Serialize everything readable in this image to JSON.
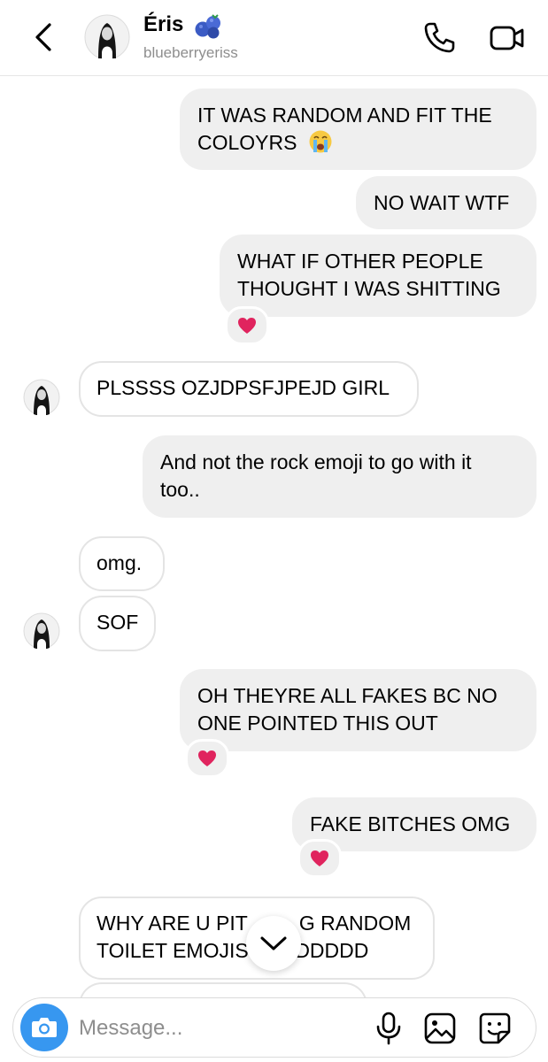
{
  "header": {
    "name": "Éris",
    "username": "blueberryeriss",
    "name_emoji_icon": "blueberries-emoji",
    "back_icon": "chevron-left-icon",
    "call_icon": "phone-icon",
    "video_icon": "video-camera-icon"
  },
  "messages": [
    {
      "side": "sent",
      "lines": [
        "IT WAS RANDOM AND FIT THE",
        "COLOYRS"
      ],
      "emoji": "loudly-crying-face"
    },
    {
      "side": "sent",
      "lines": [
        "NO WAIT WTF"
      ]
    },
    {
      "side": "sent",
      "lines": [
        "WHAT IF OTHER PEOPLE",
        "THOUGHT I WAS SHITTING"
      ],
      "reaction": "red-heart"
    },
    {
      "side": "received",
      "lines": [
        "PLSSSS OZJDPSFJPEJD GIRL"
      ],
      "avatar": true
    },
    {
      "side": "sent",
      "lines": [
        "And not the rock emoji to go with it",
        "too.."
      ]
    },
    {
      "side": "received",
      "lines": [
        "omg."
      ]
    },
    {
      "side": "received",
      "lines": [
        "SOF"
      ],
      "avatar": true
    },
    {
      "side": "sent",
      "lines": [
        "OH THEYRE ALL FAKES BC NO",
        "ONE POINTED THIS OUT"
      ],
      "reaction": "red-heart"
    },
    {
      "side": "sent",
      "lines": [
        "FAKE BITCHES OMG"
      ],
      "reaction": "red-heart"
    },
    {
      "side": "received",
      "lines": [
        "WHY ARE U PIT",
        "G RANDOM",
        "TOILET EMOJIS",
        "DDDDDD"
      ]
    }
  ],
  "composer": {
    "placeholder": "Message...",
    "camera_icon": "camera-icon",
    "mic_icon": "microphone-icon",
    "gallery_icon": "gallery-icon",
    "sticker_icon": "sticker-icon"
  },
  "scroll_icon": "chevron-down-icon",
  "colors": {
    "sent_bubble": "#efefef",
    "received_border": "#e4e4e4",
    "accent_blue": "#3797f0",
    "muted_text": "#8e8e8e",
    "heart_red": "#e0245e"
  }
}
